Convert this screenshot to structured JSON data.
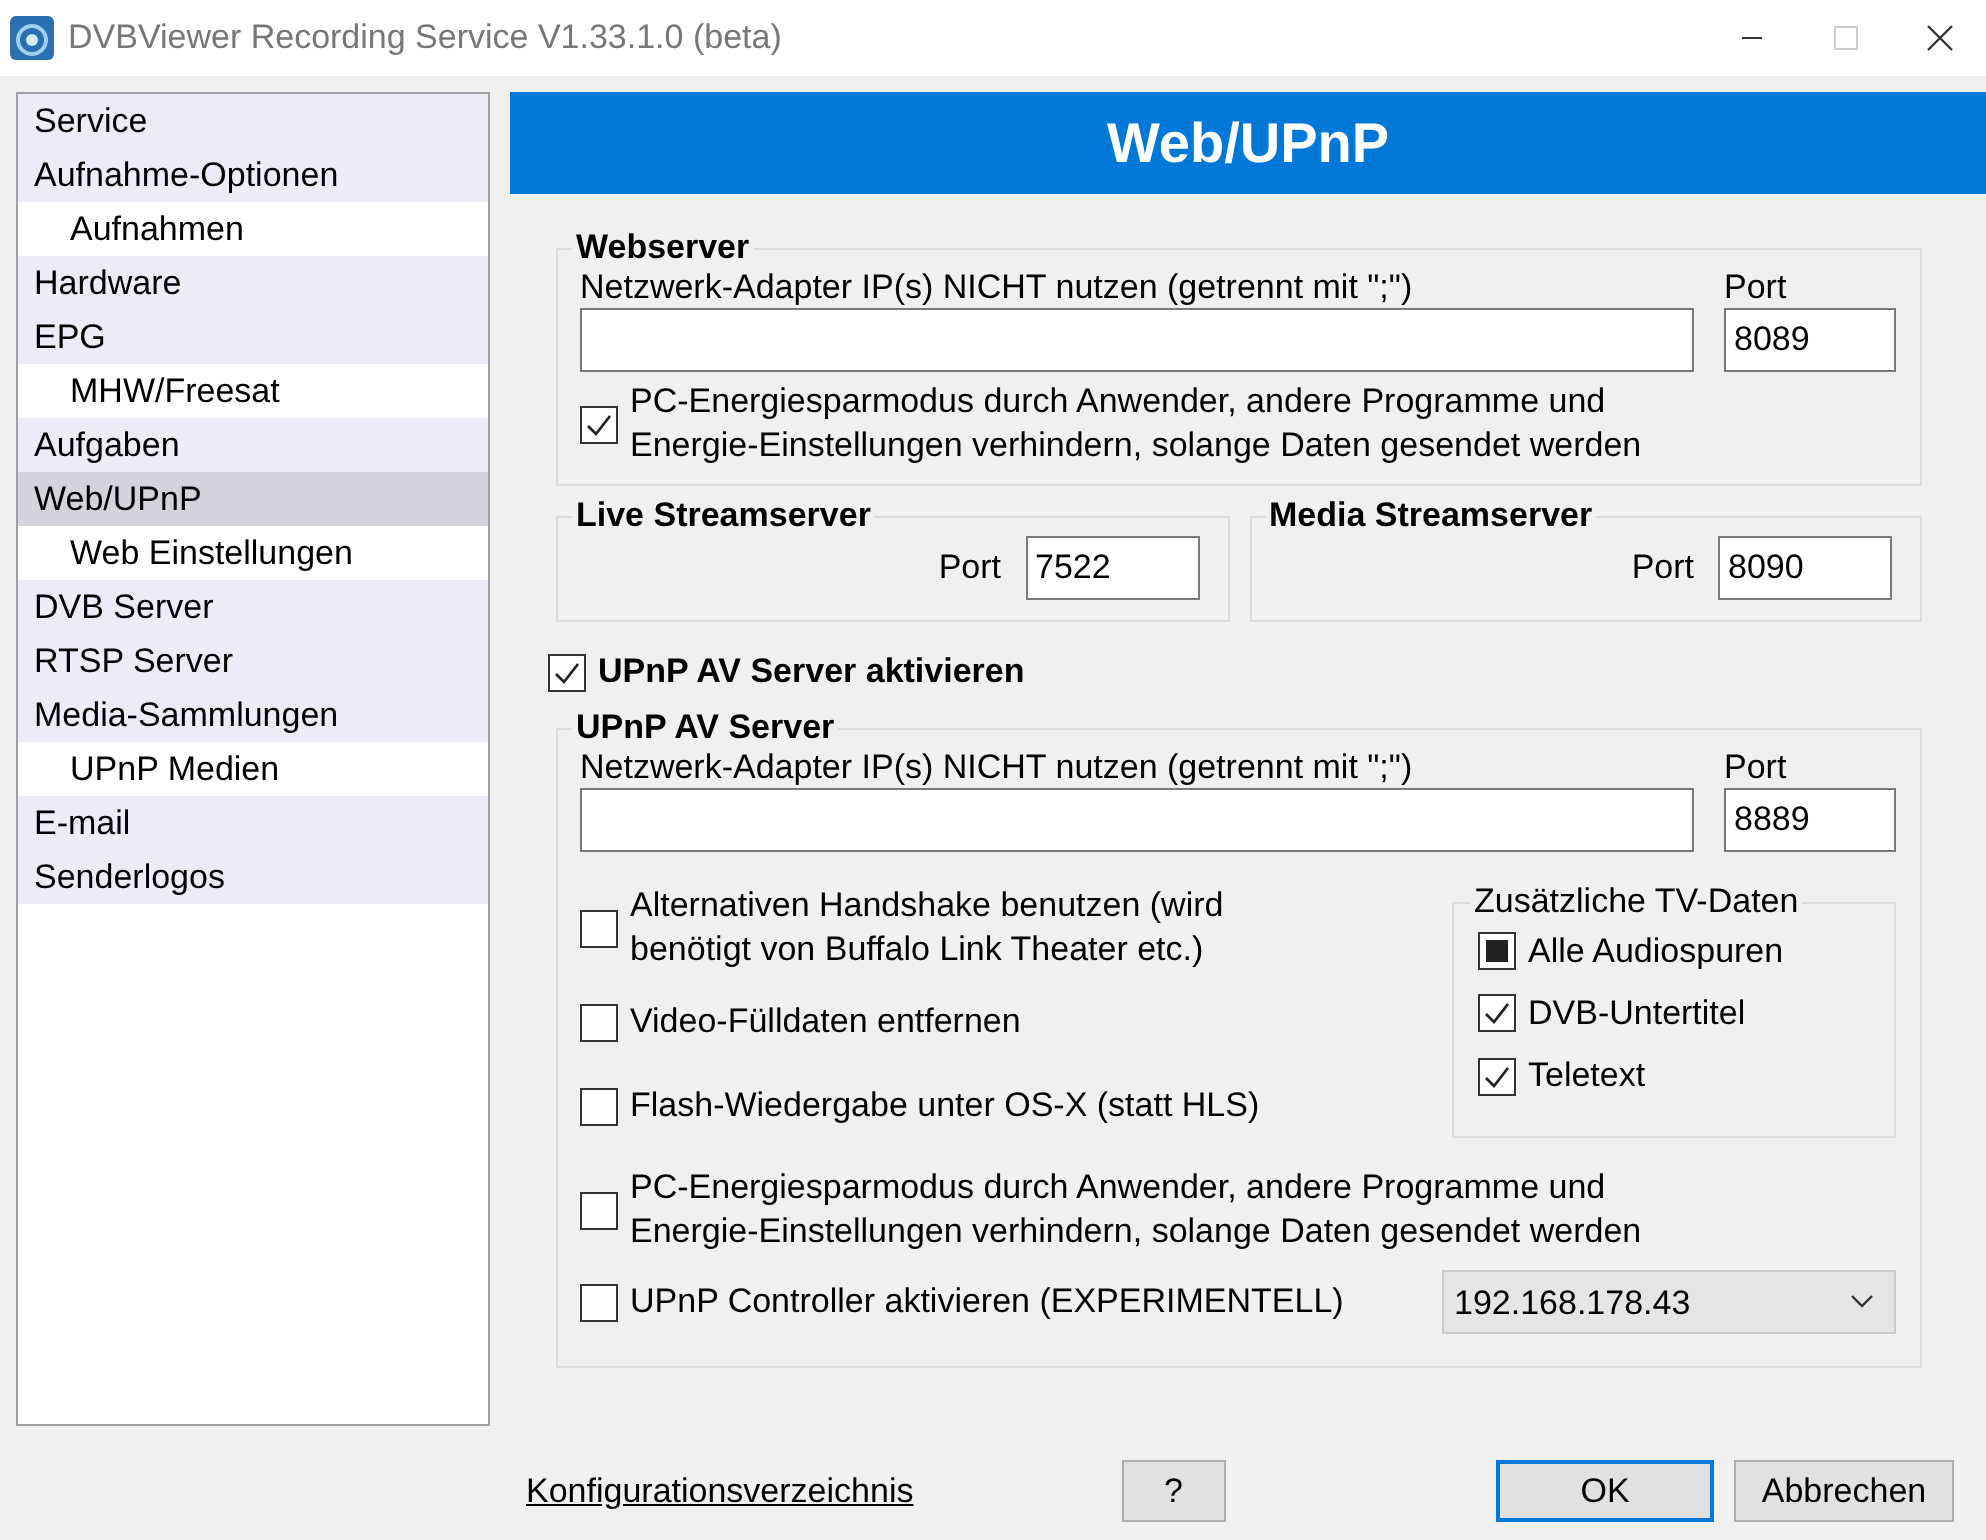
{
  "window": {
    "title": "DVBViewer Recording Service V1.33.1.0 (beta)"
  },
  "sidebar": {
    "items": [
      {
        "label": "Service",
        "selected": false
      },
      {
        "label": "Aufnahme-Optionen",
        "selected": false,
        "children": [
          {
            "label": "Aufnahmen",
            "selected": false
          }
        ]
      },
      {
        "label": "Hardware",
        "selected": false
      },
      {
        "label": "EPG",
        "selected": false,
        "children": [
          {
            "label": "MHW/Freesat",
            "selected": false
          }
        ]
      },
      {
        "label": "Aufgaben",
        "selected": false
      },
      {
        "label": "Web/UPnP",
        "selected": true,
        "children": [
          {
            "label": "Web Einstellungen",
            "selected": false
          }
        ]
      },
      {
        "label": "DVB Server",
        "selected": false
      },
      {
        "label": "RTSP Server",
        "selected": false
      },
      {
        "label": "Media-Sammlungen",
        "selected": false,
        "children": [
          {
            "label": "UPnP Medien",
            "selected": false
          }
        ]
      },
      {
        "label": "E-mail",
        "selected": false
      },
      {
        "label": "Senderlogos",
        "selected": false
      }
    ]
  },
  "panel": {
    "header": "Web/UPnP",
    "webserver": {
      "title": "Webserver",
      "ip_label": "Netzwerk-Adapter IP(s) NICHT nutzen (getrennt mit \";\")",
      "port_label": "Port",
      "port": "8089",
      "power": {
        "label": "PC-Energiesparmodus durch Anwender, andere Programme und Energie-Einstellungen verhindern, solange Daten gesendet werden",
        "checked": true
      }
    },
    "live": {
      "title": "Live Streamserver",
      "port_label": "Port",
      "port": "7522"
    },
    "media": {
      "title": "Media Streamserver",
      "port_label": "Port",
      "port": "8090"
    },
    "upnp_enable": {
      "label": "UPnP AV Server aktivieren",
      "checked": true
    },
    "upnp": {
      "title": "UPnP AV Server",
      "ip_label": "Netzwerk-Adapter IP(s) NICHT nutzen (getrennt mit \";\")",
      "port_label": "Port",
      "port": "8889",
      "options": [
        {
          "label": "Alternativen Handshake benutzen (wird benötigt von Buffalo Link Theater etc.)",
          "checked": false
        },
        {
          "label": "Video-Fülldaten entfernen",
          "checked": false
        },
        {
          "label": "Flash-Wiedergabe unter OS-X (statt HLS)",
          "checked": false
        }
      ],
      "tv_data": {
        "title": "Zusätzliche TV-Daten",
        "options": [
          {
            "label": "Alle Audiospuren",
            "kind": "tristate",
            "checked": true
          },
          {
            "label": "DVB-Untertitel",
            "kind": "checkbox",
            "checked": true
          },
          {
            "label": "Teletext",
            "kind": "checkbox",
            "checked": true
          }
        ]
      },
      "power": {
        "label": "PC-Energiesparmodus durch Anwender, andere Programme und Energie-Einstellungen verhindern, solange Daten gesendet werden",
        "checked": false
      },
      "controller": {
        "label": "UPnP Controller aktivieren (EXPERIMENTELL)",
        "checked": false
      },
      "controller_ip": "192.168.178.43"
    }
  },
  "footer": {
    "link": "Konfigurationsverzeichnis",
    "help": "?",
    "ok": "OK",
    "cancel": "Abbrechen"
  }
}
